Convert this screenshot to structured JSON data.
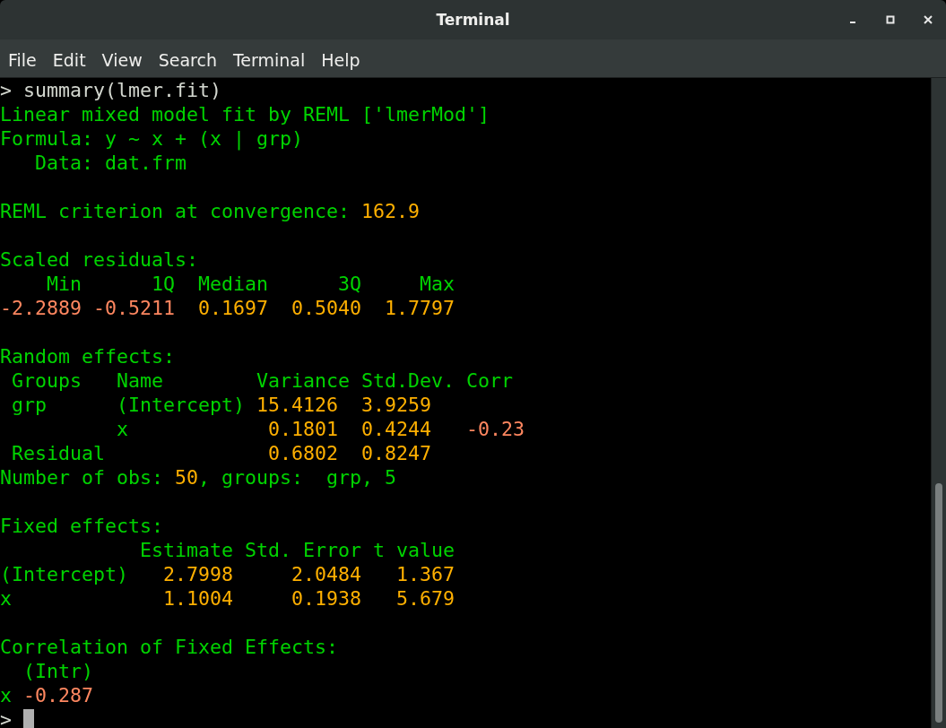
{
  "window": {
    "title": "Terminal"
  },
  "menu": [
    "File",
    "Edit",
    "View",
    "Search",
    "Terminal",
    "Help"
  ],
  "terminal": {
    "cursor_visible": true,
    "lines": [
      {
        "kind": "line",
        "segments": [
          {
            "kind": "input",
            "text": "> summary(lmer.fit)"
          }
        ]
      },
      {
        "kind": "line",
        "segments": [
          {
            "kind": "text",
            "text": "Linear mixed model fit by REML ['lmerMod']"
          }
        ]
      },
      {
        "kind": "line",
        "segments": [
          {
            "kind": "text",
            "text": "Formula: y ~ x + (x | grp)"
          }
        ]
      },
      {
        "kind": "line",
        "segments": [
          {
            "kind": "text",
            "text": "   Data: dat.frm"
          }
        ]
      },
      {
        "kind": "blank"
      },
      {
        "kind": "line",
        "segments": [
          {
            "kind": "text",
            "text": "REML criterion at convergence: "
          },
          {
            "kind": "number",
            "text": "162.9"
          }
        ]
      },
      {
        "kind": "blank"
      },
      {
        "kind": "line",
        "segments": [
          {
            "kind": "text",
            "text": "Scaled residuals:"
          }
        ]
      },
      {
        "kind": "line",
        "segments": [
          {
            "kind": "text",
            "text": "    Min      1Q  Median      3Q     Max"
          }
        ]
      },
      {
        "kind": "line",
        "segments": [
          {
            "kind": "negative",
            "text": "-2.2889"
          },
          {
            "kind": "negative",
            "text": " -0.5211"
          },
          {
            "kind": "number",
            "text": "  0.1697"
          },
          {
            "kind": "number",
            "text": "  0.5040"
          },
          {
            "kind": "number",
            "text": "  1.7797"
          }
        ]
      },
      {
        "kind": "blank"
      },
      {
        "kind": "line",
        "segments": [
          {
            "kind": "text",
            "text": "Random effects:"
          }
        ]
      },
      {
        "kind": "line",
        "segments": [
          {
            "kind": "text",
            "text": " Groups   Name        Variance Std.Dev. Corr"
          }
        ]
      },
      {
        "kind": "line",
        "segments": [
          {
            "kind": "text",
            "text": " grp      (Intercept) "
          },
          {
            "kind": "number",
            "text": "15.4126"
          },
          {
            "kind": "number",
            "text": "  3.9259"
          }
        ]
      },
      {
        "kind": "line",
        "segments": [
          {
            "kind": "text",
            "text": "          x            "
          },
          {
            "kind": "number",
            "text": "0.1801"
          },
          {
            "kind": "number",
            "text": "  0.4244"
          },
          {
            "kind": "negative",
            "text": "   -0.23"
          }
        ]
      },
      {
        "kind": "line",
        "segments": [
          {
            "kind": "text",
            "text": " Residual              "
          },
          {
            "kind": "number",
            "text": "0.6802"
          },
          {
            "kind": "number",
            "text": "  0.8247"
          }
        ]
      },
      {
        "kind": "line",
        "segments": [
          {
            "kind": "text",
            "text": "Number of obs: "
          },
          {
            "kind": "number",
            "text": "50"
          },
          {
            "kind": "text",
            "text": ", groups:  grp, 5"
          }
        ]
      },
      {
        "kind": "blank"
      },
      {
        "kind": "line",
        "segments": [
          {
            "kind": "text",
            "text": "Fixed effects:"
          }
        ]
      },
      {
        "kind": "line",
        "segments": [
          {
            "kind": "text",
            "text": "            Estimate Std. Error t value"
          }
        ]
      },
      {
        "kind": "line",
        "segments": [
          {
            "kind": "text",
            "text": "(Intercept)   "
          },
          {
            "kind": "number",
            "text": "2.7998"
          },
          {
            "kind": "number",
            "text": "     2.0484"
          },
          {
            "kind": "number",
            "text": "   1.367"
          }
        ]
      },
      {
        "kind": "line",
        "segments": [
          {
            "kind": "text",
            "text": "x             "
          },
          {
            "kind": "number",
            "text": "1.1004"
          },
          {
            "kind": "number",
            "text": "     0.1938"
          },
          {
            "kind": "number",
            "text": "   5.679"
          }
        ]
      },
      {
        "kind": "blank"
      },
      {
        "kind": "line",
        "segments": [
          {
            "kind": "text",
            "text": "Correlation of Fixed Effects:"
          }
        ]
      },
      {
        "kind": "line",
        "segments": [
          {
            "kind": "text",
            "text": "  (Intr)"
          }
        ]
      },
      {
        "kind": "line",
        "segments": [
          {
            "kind": "text",
            "text": "x "
          },
          {
            "kind": "negative",
            "text": "-0.287"
          }
        ]
      },
      {
        "kind": "line",
        "segments": [
          {
            "kind": "input",
            "text": ">"
          }
        ]
      }
    ]
  }
}
